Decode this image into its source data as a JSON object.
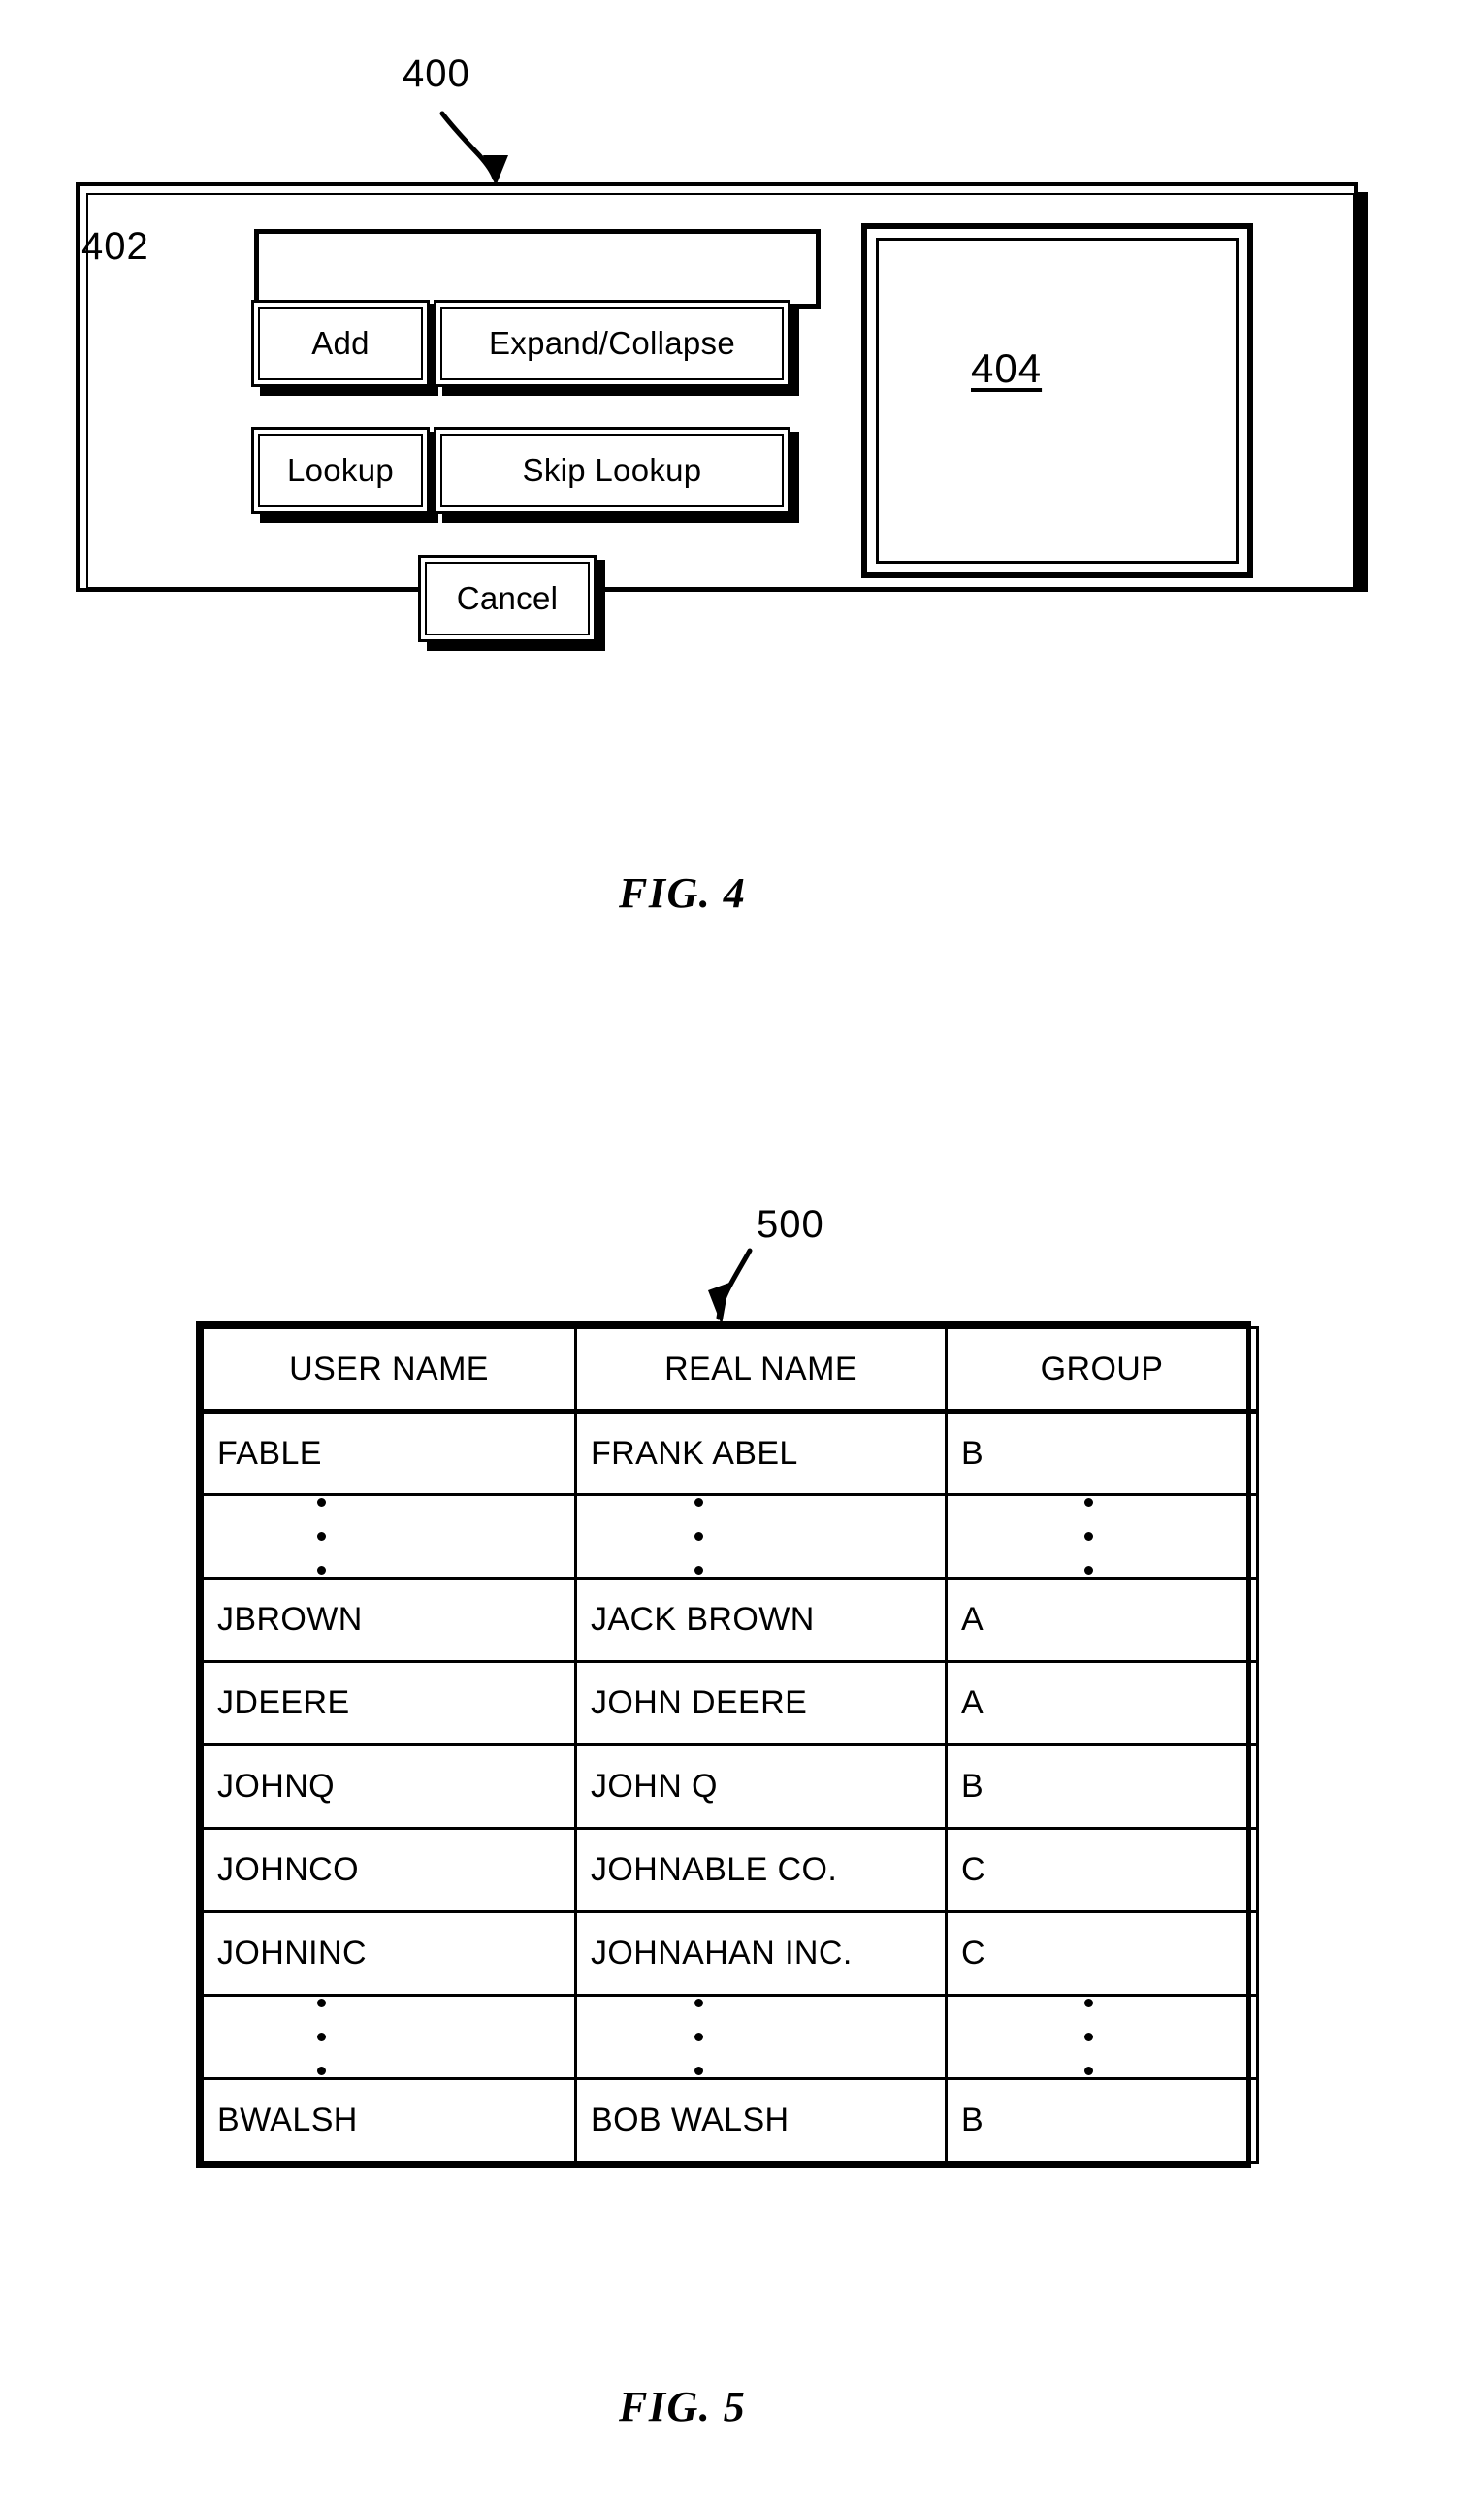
{
  "figures": [
    {
      "id": "fig4",
      "caption": "FIG. 4",
      "reference_numerals": {
        "dialog": "400",
        "text_field": "402",
        "list_panel": "404"
      },
      "dialog": {
        "text_field_value": "",
        "buttons": [
          {
            "label": "Add"
          },
          {
            "label": "Expand/Collapse"
          },
          {
            "label": "Lookup"
          },
          {
            "label": "Skip Lookup"
          },
          {
            "label": "Cancel"
          }
        ],
        "list_panel_label": "404"
      }
    },
    {
      "id": "fig5",
      "caption": "FIG. 5",
      "reference_numerals": {
        "table": "500"
      },
      "table": {
        "columns": [
          "USER NAME",
          "REAL NAME",
          "GROUP"
        ],
        "rows": [
          {
            "type": "data",
            "cells": [
              "FABLE",
              "FRANK ABEL",
              "B"
            ]
          },
          {
            "type": "ellipsis",
            "cells": [
              "⋮",
              "⋮",
              "⋮"
            ]
          },
          {
            "type": "data",
            "cells": [
              "JBROWN",
              "JACK BROWN",
              "A"
            ]
          },
          {
            "type": "data",
            "cells": [
              "JDEERE",
              "JOHN DEERE",
              "A"
            ]
          },
          {
            "type": "data",
            "cells": [
              "JOHNQ",
              "JOHN Q",
              "B"
            ]
          },
          {
            "type": "data",
            "cells": [
              "JOHNCO",
              "JOHNABLE CO.",
              "C"
            ]
          },
          {
            "type": "data",
            "cells": [
              "JOHNINC",
              "JOHNAHAN INC.",
              "C"
            ]
          },
          {
            "type": "ellipsis",
            "cells": [
              "⋮",
              "⋮",
              "⋮"
            ]
          },
          {
            "type": "data",
            "cells": [
              "BWALSH",
              "BOB WALSH",
              "B"
            ]
          }
        ]
      }
    }
  ],
  "colors": {
    "ink": "#000000",
    "paper": "#ffffff"
  }
}
